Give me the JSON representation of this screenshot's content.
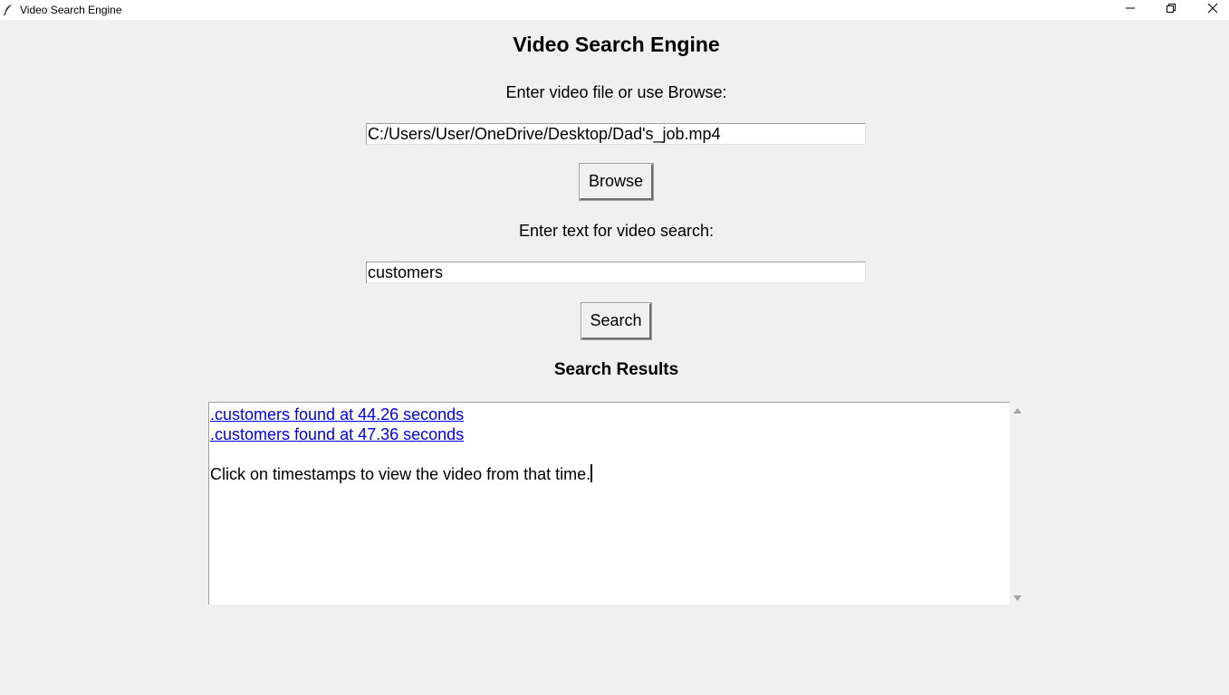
{
  "window": {
    "title": "Video Search Engine",
    "app_icon": "feather-icon",
    "controls": [
      "minimize-icon",
      "maximize-icon",
      "close-icon"
    ]
  },
  "main": {
    "heading": "Video Search Engine",
    "file_label": "Enter video file or use Browse:",
    "file_value": "C:/Users/User/OneDrive/Desktop/Dad's_job.mp4",
    "browse_label": "Browse",
    "search_label": "Enter text for video search:",
    "search_value": "customers",
    "search_button": "Search",
    "results_heading": "Search Results",
    "results": [
      ".customers found at 44.26 seconds",
      ".customers found at 47.36 seconds"
    ],
    "hint": "Click on timestamps to view the video from that time."
  },
  "colors": {
    "background": "#f0f0f0",
    "link": "#0000ee",
    "titlebar": "#ffffff"
  }
}
